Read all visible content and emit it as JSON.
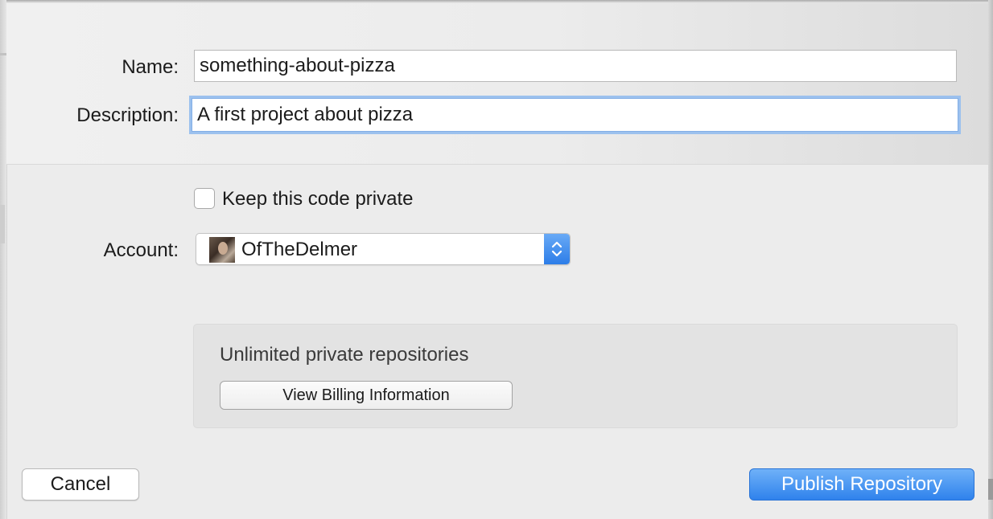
{
  "form": {
    "name_label": "Name:",
    "name_value": "something-about-pizza",
    "description_label": "Description:",
    "description_value": "A first project about pizza"
  },
  "options": {
    "private_label": "Keep this code private",
    "private_checked": false,
    "account_label": "Account:",
    "account_value": "OfTheDelmer"
  },
  "billing": {
    "message": "Unlimited private repositories",
    "button_label": "View Billing Information"
  },
  "actions": {
    "cancel_label": "Cancel",
    "publish_label": "Publish Repository"
  },
  "colors": {
    "accent": "#3b8bf0",
    "focus_ring": "#9cc1ee"
  }
}
